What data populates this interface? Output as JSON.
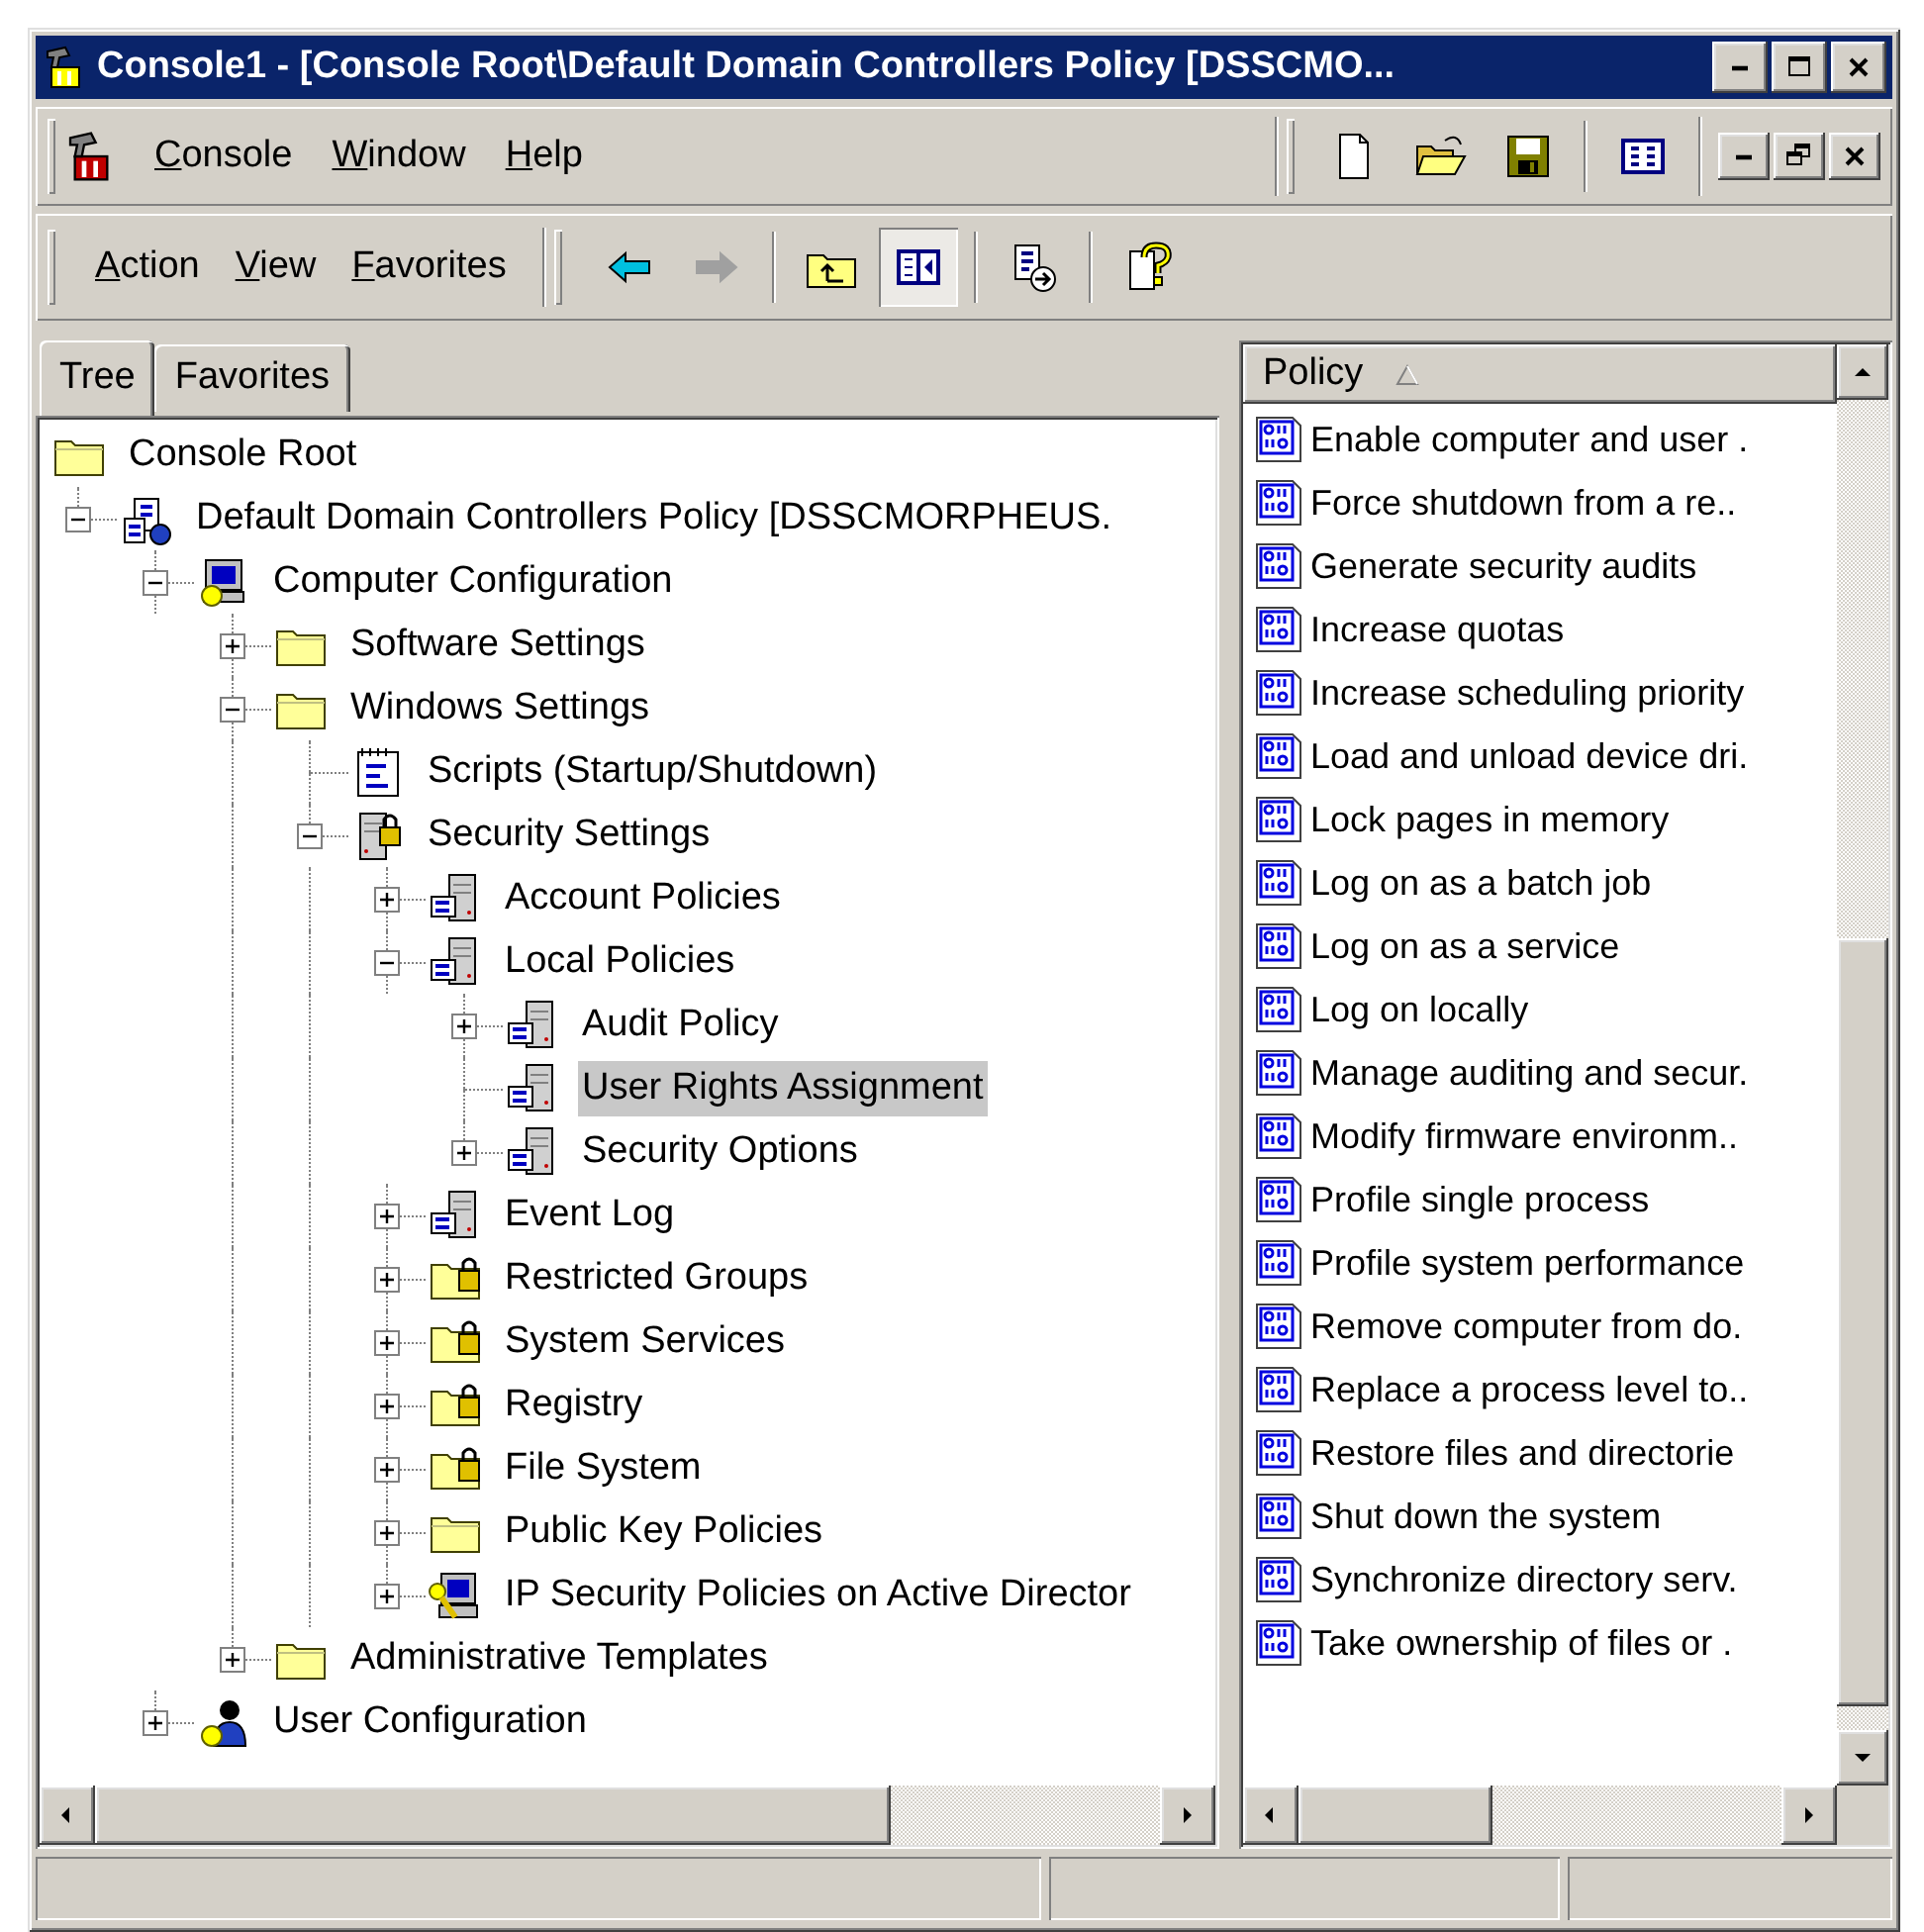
{
  "window": {
    "title": "Console1 - [Console Root\\Default Domain Controllers Policy [DSSCMO..."
  },
  "menu_bar": {
    "items": [
      "Console",
      "Window",
      "Help"
    ],
    "buttons": [
      {
        "kind": "new"
      },
      {
        "kind": "open"
      },
      {
        "kind": "save"
      },
      {
        "kind": "details"
      }
    ]
  },
  "action_bar": {
    "items": [
      "Action",
      "View",
      "Favorites"
    ],
    "buttons": [
      {
        "kind": "back",
        "disabled": false,
        "pressed": false
      },
      {
        "kind": "forward",
        "disabled": true,
        "pressed": false
      },
      {
        "kind": "up",
        "pressed": false
      },
      {
        "kind": "show-tree",
        "pressed": true
      },
      {
        "kind": "export",
        "pressed": false
      },
      {
        "kind": "help",
        "pressed": false
      }
    ]
  },
  "tabs": [
    {
      "label": "Tree",
      "selected": true
    },
    {
      "label": "Favorites",
      "selected": false
    }
  ],
  "tree": [
    {
      "label": "Console Root",
      "kind": "folder",
      "selected": false,
      "children": [
        {
          "label": "Default Domain Controllers Policy [DSSCMORPHEUS.",
          "kind": "policy",
          "expanded": true,
          "selected": false,
          "children": [
            {
              "label": "Computer Configuration",
              "kind": "computer",
              "expanded": true,
              "selected": false,
              "children": [
                {
                  "label": "Software Settings",
                  "kind": "folder",
                  "expanded": false,
                  "selected": false
                },
                {
                  "label": "Windows Settings",
                  "kind": "folder",
                  "expanded": true,
                  "selected": false,
                  "children": [
                    {
                      "label": "Scripts (Startup/Shutdown)",
                      "kind": "scripts",
                      "selected": false
                    },
                    {
                      "label": "Security Settings",
                      "kind": "security",
                      "expanded": true,
                      "selected": false,
                      "children": [
                        {
                          "label": "Account Policies",
                          "kind": "server",
                          "expanded": false,
                          "selected": false
                        },
                        {
                          "label": "Local Policies",
                          "kind": "server",
                          "expanded": true,
                          "selected": false,
                          "children": [
                            {
                              "label": "Audit Policy",
                              "kind": "server",
                              "expanded": false,
                              "selected": false
                            },
                            {
                              "label": "User Rights Assignment",
                              "kind": "server",
                              "selected": true
                            },
                            {
                              "label": "Security Options",
                              "kind": "server",
                              "expanded": false,
                              "selected": false
                            }
                          ]
                        },
                        {
                          "label": "Event Log",
                          "kind": "server",
                          "expanded": false,
                          "selected": false
                        },
                        {
                          "label": "Restricted Groups",
                          "kind": "locked-folder",
                          "expanded": false,
                          "selected": false
                        },
                        {
                          "label": "System Services",
                          "kind": "locked-folder",
                          "expanded": false,
                          "selected": false
                        },
                        {
                          "label": "Registry",
                          "kind": "locked-folder",
                          "expanded": false,
                          "selected": false
                        },
                        {
                          "label": "File System",
                          "kind": "locked-folder",
                          "expanded": false,
                          "selected": false
                        },
                        {
                          "label": "Public Key Policies",
                          "kind": "folder",
                          "expanded": false,
                          "selected": false
                        },
                        {
                          "label": "IP Security Policies on Active Director",
                          "kind": "ipsec",
                          "expanded": false,
                          "selected": false
                        }
                      ]
                    }
                  ]
                },
                {
                  "label": "Administrative Templates",
                  "kind": "folder",
                  "expanded": false,
                  "selected": false
                }
              ]
            },
            {
              "label": "User Configuration",
              "kind": "user",
              "expanded": false,
              "selected": false
            }
          ]
        }
      ]
    }
  ],
  "list": {
    "column": {
      "label": "Policy",
      "sort_ascending": true
    },
    "rows": [
      "Enable computer and user .",
      "Force shutdown from a re..",
      "Generate security audits",
      "Increase quotas",
      "Increase scheduling priority",
      "Load and unload device dri.",
      "Lock pages in memory",
      "Log on as a batch job",
      "Log on as a service",
      "Log on locally",
      "Manage auditing and secur.",
      "Modify firmware environm..",
      "Profile single process",
      "Profile system performance",
      "Remove computer from do.",
      "Replace a process level to..",
      "Restore files and directorie",
      "Shut down the system",
      "Synchronize directory serv.",
      "Take ownership of files or ."
    ]
  }
}
